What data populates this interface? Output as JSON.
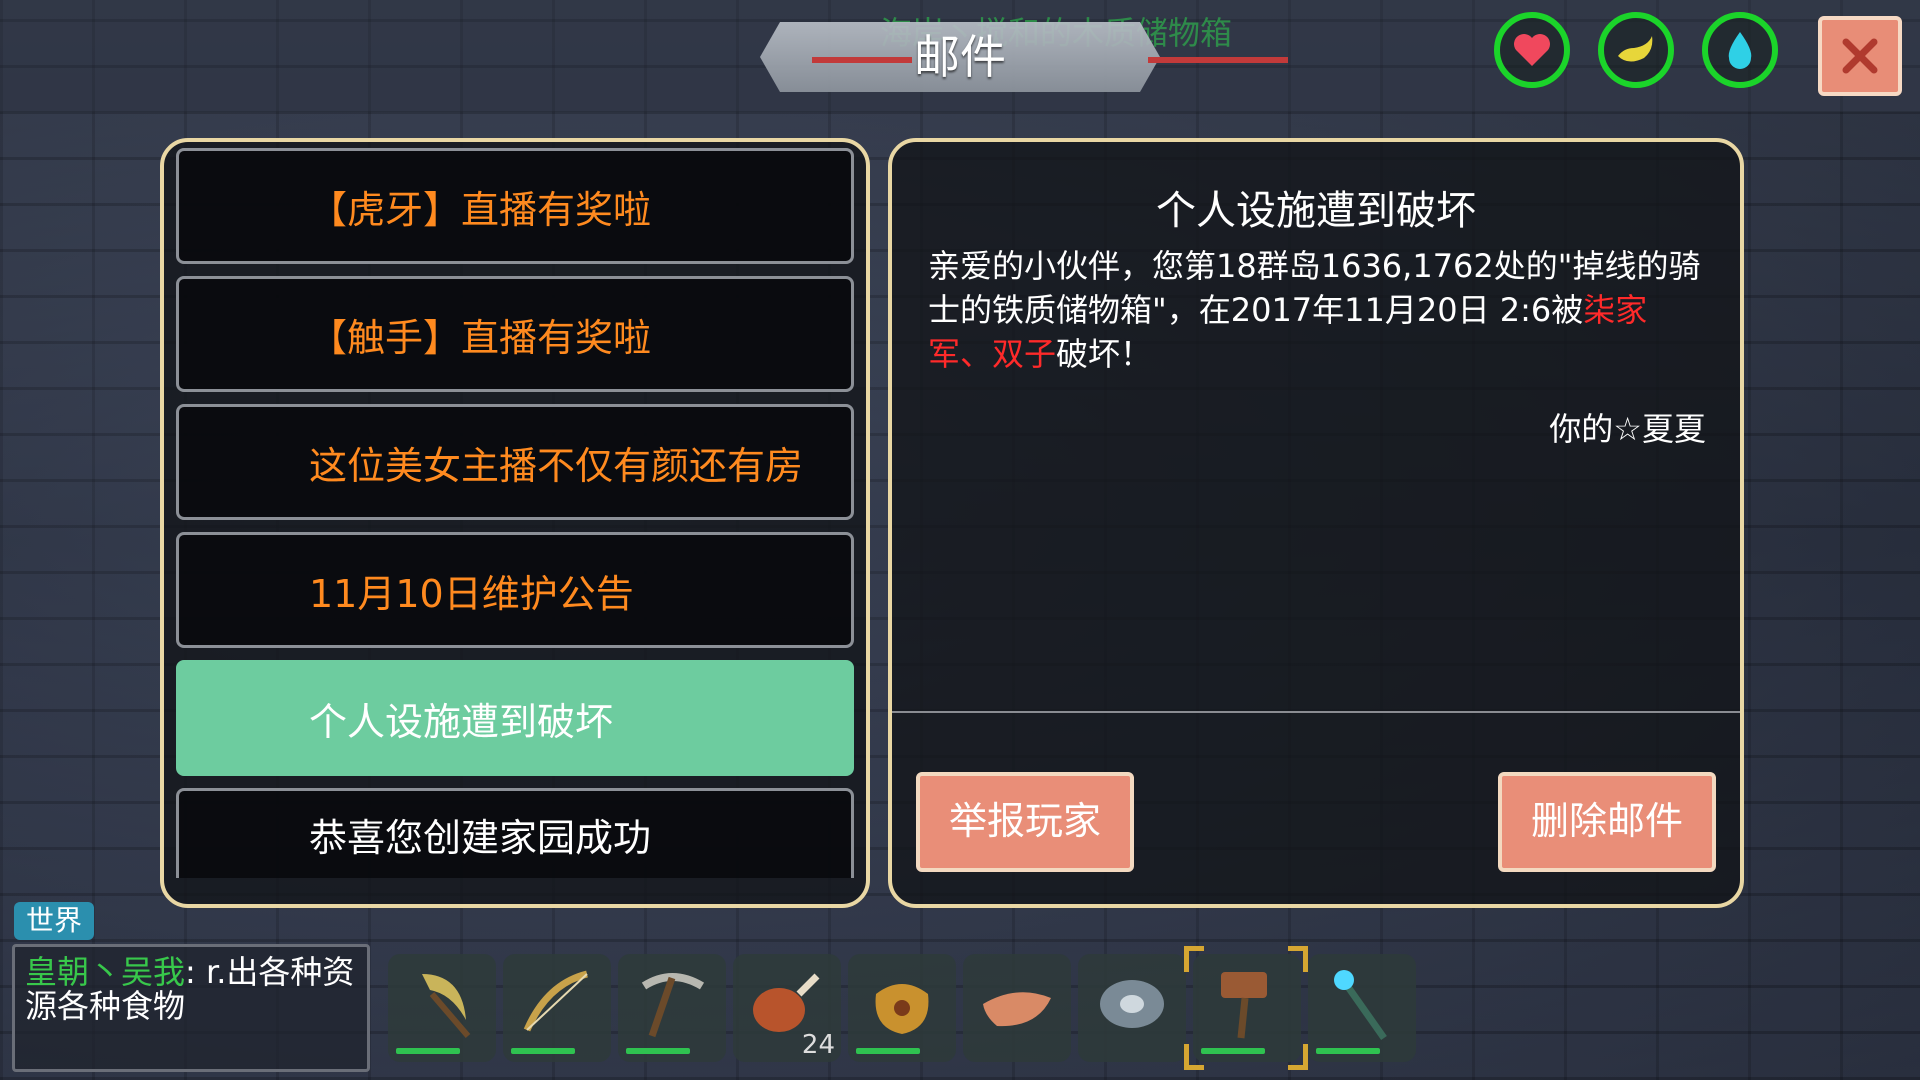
{
  "header": {
    "ghost_text": "海岸丶搅和的木质储物箱",
    "title": "邮件"
  },
  "status_icons": [
    "heart-icon",
    "stamina-icon",
    "water-drop-icon"
  ],
  "colors": {
    "accent_green": "#1bd42a",
    "panel_border": "#e9d7a4",
    "selected_item": "#6dcc9f",
    "unread_text": "#ff8a1f",
    "button": "#e98e78",
    "highlight_red": "#ff2a2a"
  },
  "mail_list": [
    {
      "label": "【虎牙】直播有奖啦",
      "state": "unread"
    },
    {
      "label": "【触手】直播有奖啦",
      "state": "unread"
    },
    {
      "label": "这位美女主播不仅有颜还有房",
      "state": "unread"
    },
    {
      "label": "11月10日维护公告",
      "state": "unread"
    },
    {
      "label": "个人设施遭到破坏",
      "state": "selected"
    },
    {
      "label": "恭喜您创建家园成功",
      "state": "read"
    }
  ],
  "detail": {
    "title": "个人设施遭到破坏",
    "body_prefix": "亲爱的小伙伴，您第18群岛1636,1762处的\"掉线的骑士的铁质储物箱\"，在2017年11月20日 2:6被",
    "attacker1": "柒家军",
    "separator": "、",
    "attacker2": "双子",
    "body_suffix": "破坏！",
    "signature": "你的☆夏夏",
    "report_button": "举报玩家",
    "delete_button": "删除邮件"
  },
  "chat": {
    "channel": "世界",
    "name": "皇朝丶吴我",
    "message": ": r.出各种资源各种食物"
  },
  "hotbar": [
    {
      "icon": "scythe-icon",
      "count": ""
    },
    {
      "icon": "bow-icon",
      "count": ""
    },
    {
      "icon": "pickaxe-icon",
      "count": ""
    },
    {
      "icon": "drumstick-icon",
      "count": "24"
    },
    {
      "icon": "water-pouch-icon",
      "count": ""
    },
    {
      "icon": "leaf-boat-icon",
      "count": ""
    },
    {
      "icon": "shield-icon",
      "count": ""
    },
    {
      "icon": "hammer-icon",
      "count": "",
      "selected": true
    },
    {
      "icon": "magic-staff-icon",
      "count": ""
    }
  ]
}
